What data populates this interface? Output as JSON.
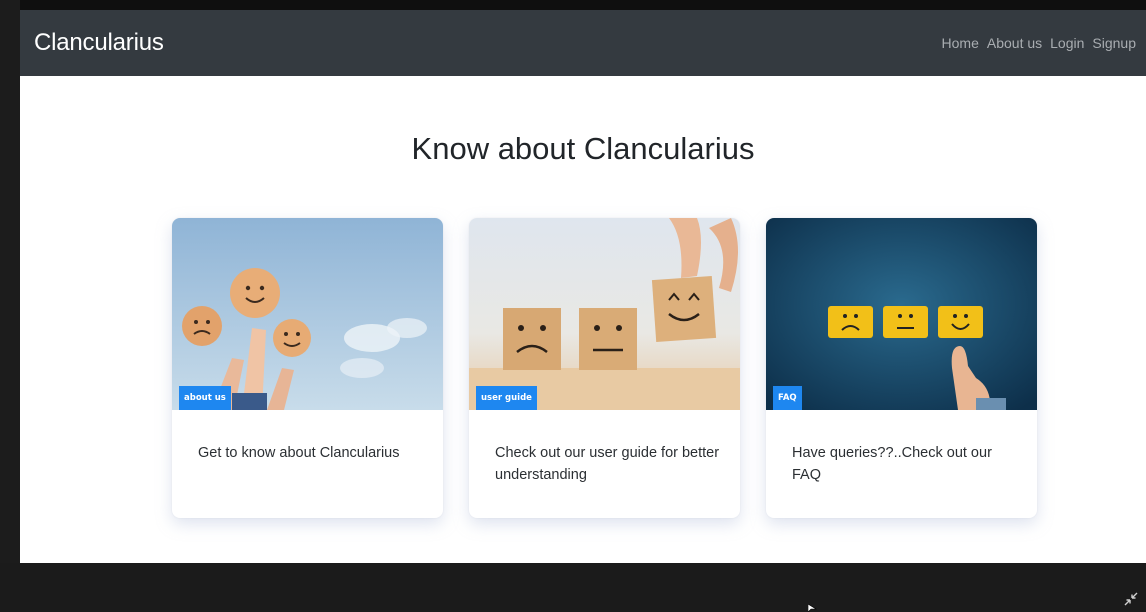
{
  "navbar": {
    "brand": "Clancularius",
    "links": [
      "Home",
      "About us",
      "Login",
      "Signup"
    ]
  },
  "main": {
    "heading": "Know about Clancularius",
    "cards": [
      {
        "badge": "about us",
        "text": "Get to know about Clancularius",
        "image_icon": "smiley-speech-bubbles-icon"
      },
      {
        "badge": "user guide",
        "text": "Check out our user guide for better understanding",
        "image_icon": "wooden-emoji-blocks-icon"
      },
      {
        "badge": "FAQ",
        "text": "Have queries??..Check out our FAQ",
        "image_icon": "rating-emoji-buttons-icon"
      }
    ]
  },
  "colors": {
    "navbar_bg": "#343a40",
    "badge_bg": "#1e87f0",
    "page_bg": "#ffffff",
    "frame_bg": "#1b1b1b"
  },
  "icons": {
    "expand": "exit-fullscreen-icon",
    "cursor": "mouse-cursor-icon"
  }
}
